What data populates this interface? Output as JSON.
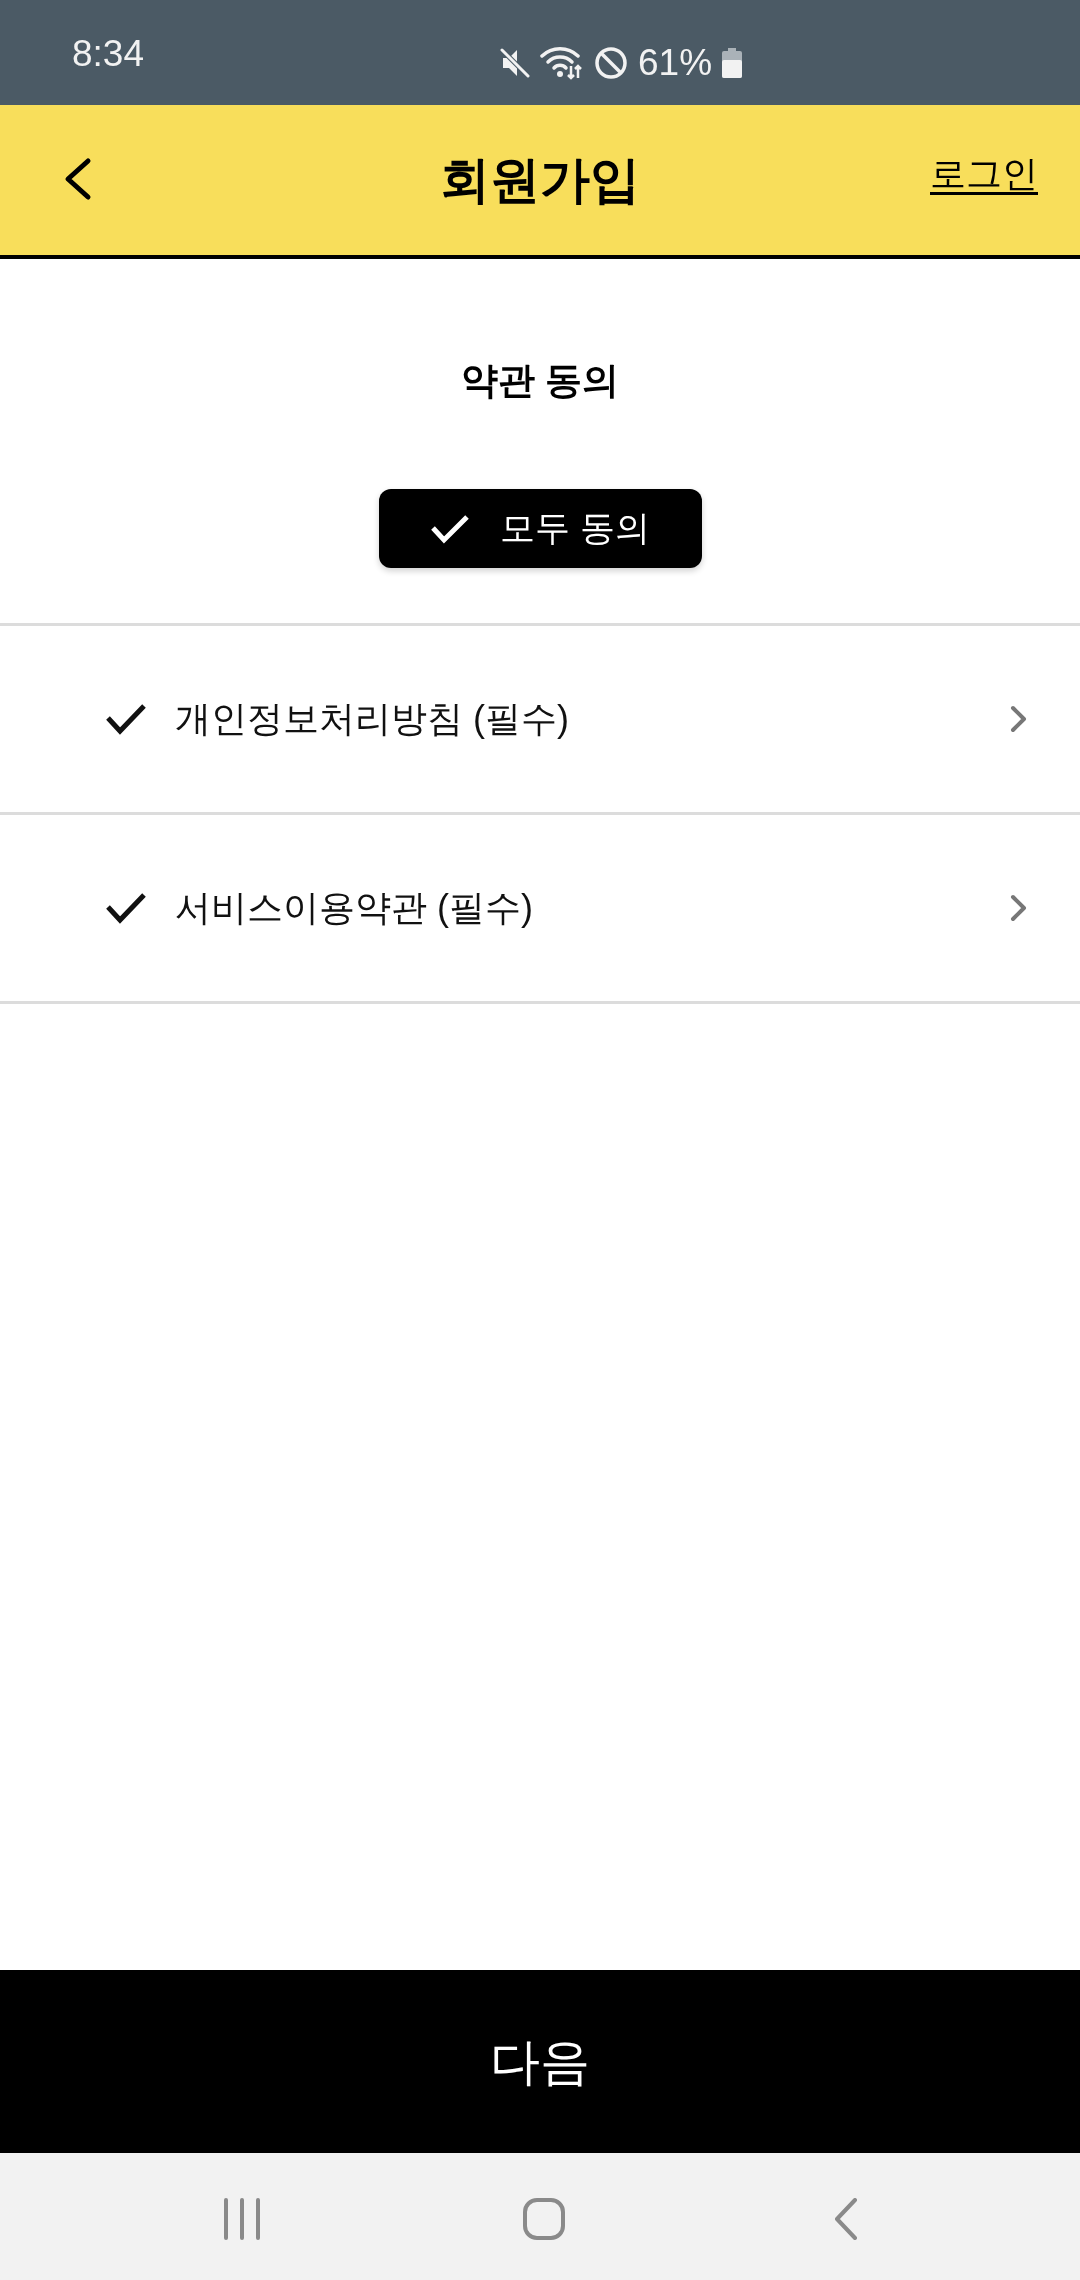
{
  "status_bar": {
    "time": "8:34",
    "battery": "61%"
  },
  "header": {
    "title": "회원가입",
    "login_link": "로그인"
  },
  "terms": {
    "title": "약관 동의",
    "agree_all": {
      "label": "모두 동의",
      "checked": true
    },
    "items": [
      {
        "label": "개인정보처리방침 (필수)",
        "checked": true
      },
      {
        "label": "서비스이용약관 (필수)",
        "checked": true
      }
    ]
  },
  "next_button": {
    "label": "다음"
  }
}
